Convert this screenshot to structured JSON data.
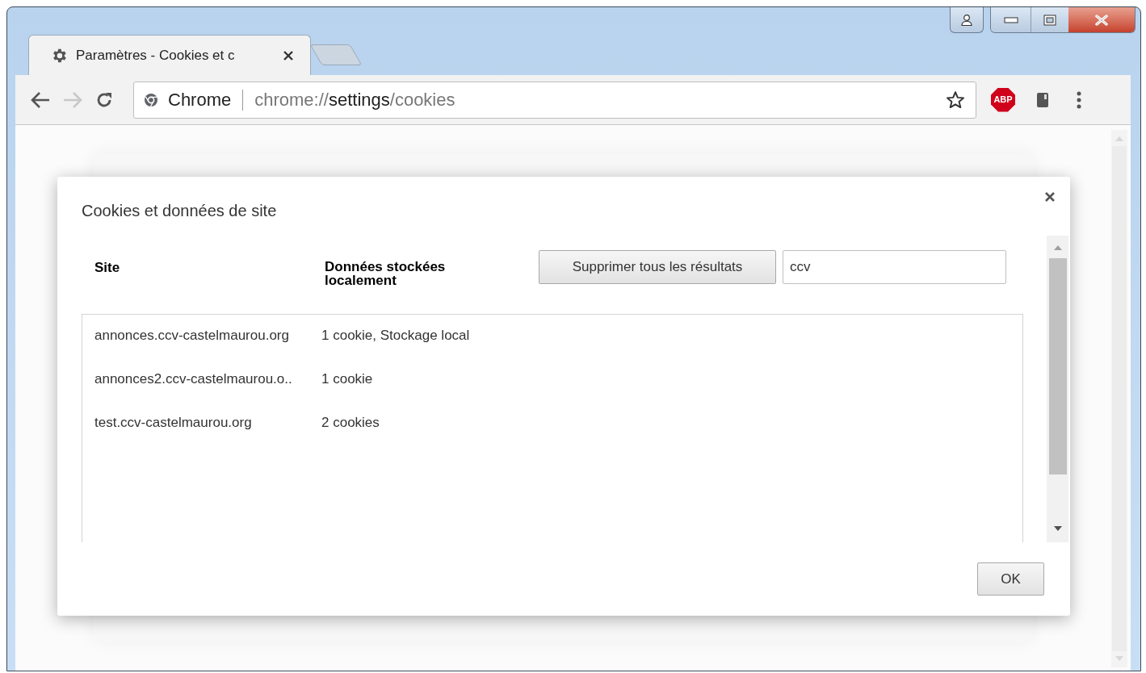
{
  "tabs": [
    {
      "title": "Paramètres - Cookies et c",
      "selected": true
    }
  ],
  "nav_buttons": [
    {
      "kind": "back",
      "disabled": false
    },
    {
      "kind": "forward",
      "disabled": true
    },
    {
      "kind": "reload",
      "disabled": false
    }
  ],
  "omnibox": {
    "chip": "Chrome",
    "url_scheme": "chrome://",
    "url_host": "settings",
    "url_path": "/cookies"
  },
  "extensions": [
    {
      "kind": "abp",
      "label": "ABP"
    },
    {
      "kind": "book"
    }
  ],
  "dialog": {
    "title": "Cookies et données de site",
    "columns": [
      "Site",
      "Données stockées localement"
    ],
    "remove_all_button": "Supprimer tous les résultats",
    "search": {
      "value": "ccv"
    },
    "rows": [
      {
        "site": "annonces.ccv-castelmaurou.org",
        "data": "1 cookie, Stockage local"
      },
      {
        "site": "annonces2.ccv-castelmaurou.o..",
        "data": "1 cookie"
      },
      {
        "site": "test.ccv-castelmaurou.org",
        "data": "2 cookies"
      }
    ],
    "ok_button": "OK"
  }
}
